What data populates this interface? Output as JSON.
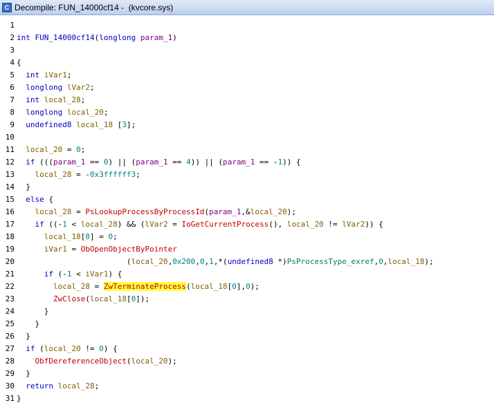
{
  "window": {
    "title": "Decompile: FUN_14000cf14 -  (kvcore.sys)",
    "icon": "decompile-icon"
  },
  "code_lines": [
    {
      "n": "1",
      "t": ""
    },
    {
      "n": "2",
      "t": "int FUN_14000cf14(longlong param_1)"
    },
    {
      "n": "3",
      "t": ""
    },
    {
      "n": "4",
      "t": "{"
    },
    {
      "n": "5",
      "t": "  int iVar1;"
    },
    {
      "n": "6",
      "t": "  longlong lVar2;"
    },
    {
      "n": "7",
      "t": "  int local_28;"
    },
    {
      "n": "8",
      "t": "  longlong local_20;"
    },
    {
      "n": "9",
      "t": "  undefined8 local_18 [3];"
    },
    {
      "n": "10",
      "t": ""
    },
    {
      "n": "11",
      "t": "  local_20 = 0;"
    },
    {
      "n": "12",
      "t": "  if (((param_1 == 0) || (param_1 == 4)) || (param_1 == -1)) {"
    },
    {
      "n": "13",
      "t": "    local_28 = -0x3ffffff3;"
    },
    {
      "n": "14",
      "t": "  }"
    },
    {
      "n": "15",
      "t": "  else {"
    },
    {
      "n": "16",
      "t": "    local_28 = PsLookupProcessByProcessId(param_1,&local_20);"
    },
    {
      "n": "17",
      "t": "    if ((-1 < local_28) && (lVar2 = IoGetCurrentProcess(), local_20 != lVar2)) {"
    },
    {
      "n": "18",
      "t": "      local_18[0] = 0;"
    },
    {
      "n": "19",
      "t": "      iVar1 = ObOpenObjectByPointer"
    },
    {
      "n": "20",
      "t": "                        (local_20,0x200,0,1,*(undefined8 *)PsProcessType_exref,0,local_18);"
    },
    {
      "n": "21",
      "t": "      if (-1 < iVar1) {"
    },
    {
      "n": "22",
      "t": "        local_28 = ZwTerminateProcess(local_18[0],0);"
    },
    {
      "n": "23",
      "t": "        ZwClose(local_18[0]);"
    },
    {
      "n": "24",
      "t": "      }"
    },
    {
      "n": "25",
      "t": "    }"
    },
    {
      "n": "26",
      "t": "  }"
    },
    {
      "n": "27",
      "t": "  if (local_20 != 0) {"
    },
    {
      "n": "28",
      "t": "    ObfDereferenceObject(local_20);"
    },
    {
      "n": "29",
      "t": "  }"
    },
    {
      "n": "30",
      "t": "  return local_28;"
    },
    {
      "n": "31",
      "t": "}"
    }
  ],
  "highlight": "ZwTerminateProcess",
  "colors": {
    "keyword": "#0000c0",
    "function": "#c00000",
    "variable": "#806000",
    "parameter": "#800080",
    "number": "#008080",
    "global": "#008060",
    "highlight": "#ffff40"
  }
}
